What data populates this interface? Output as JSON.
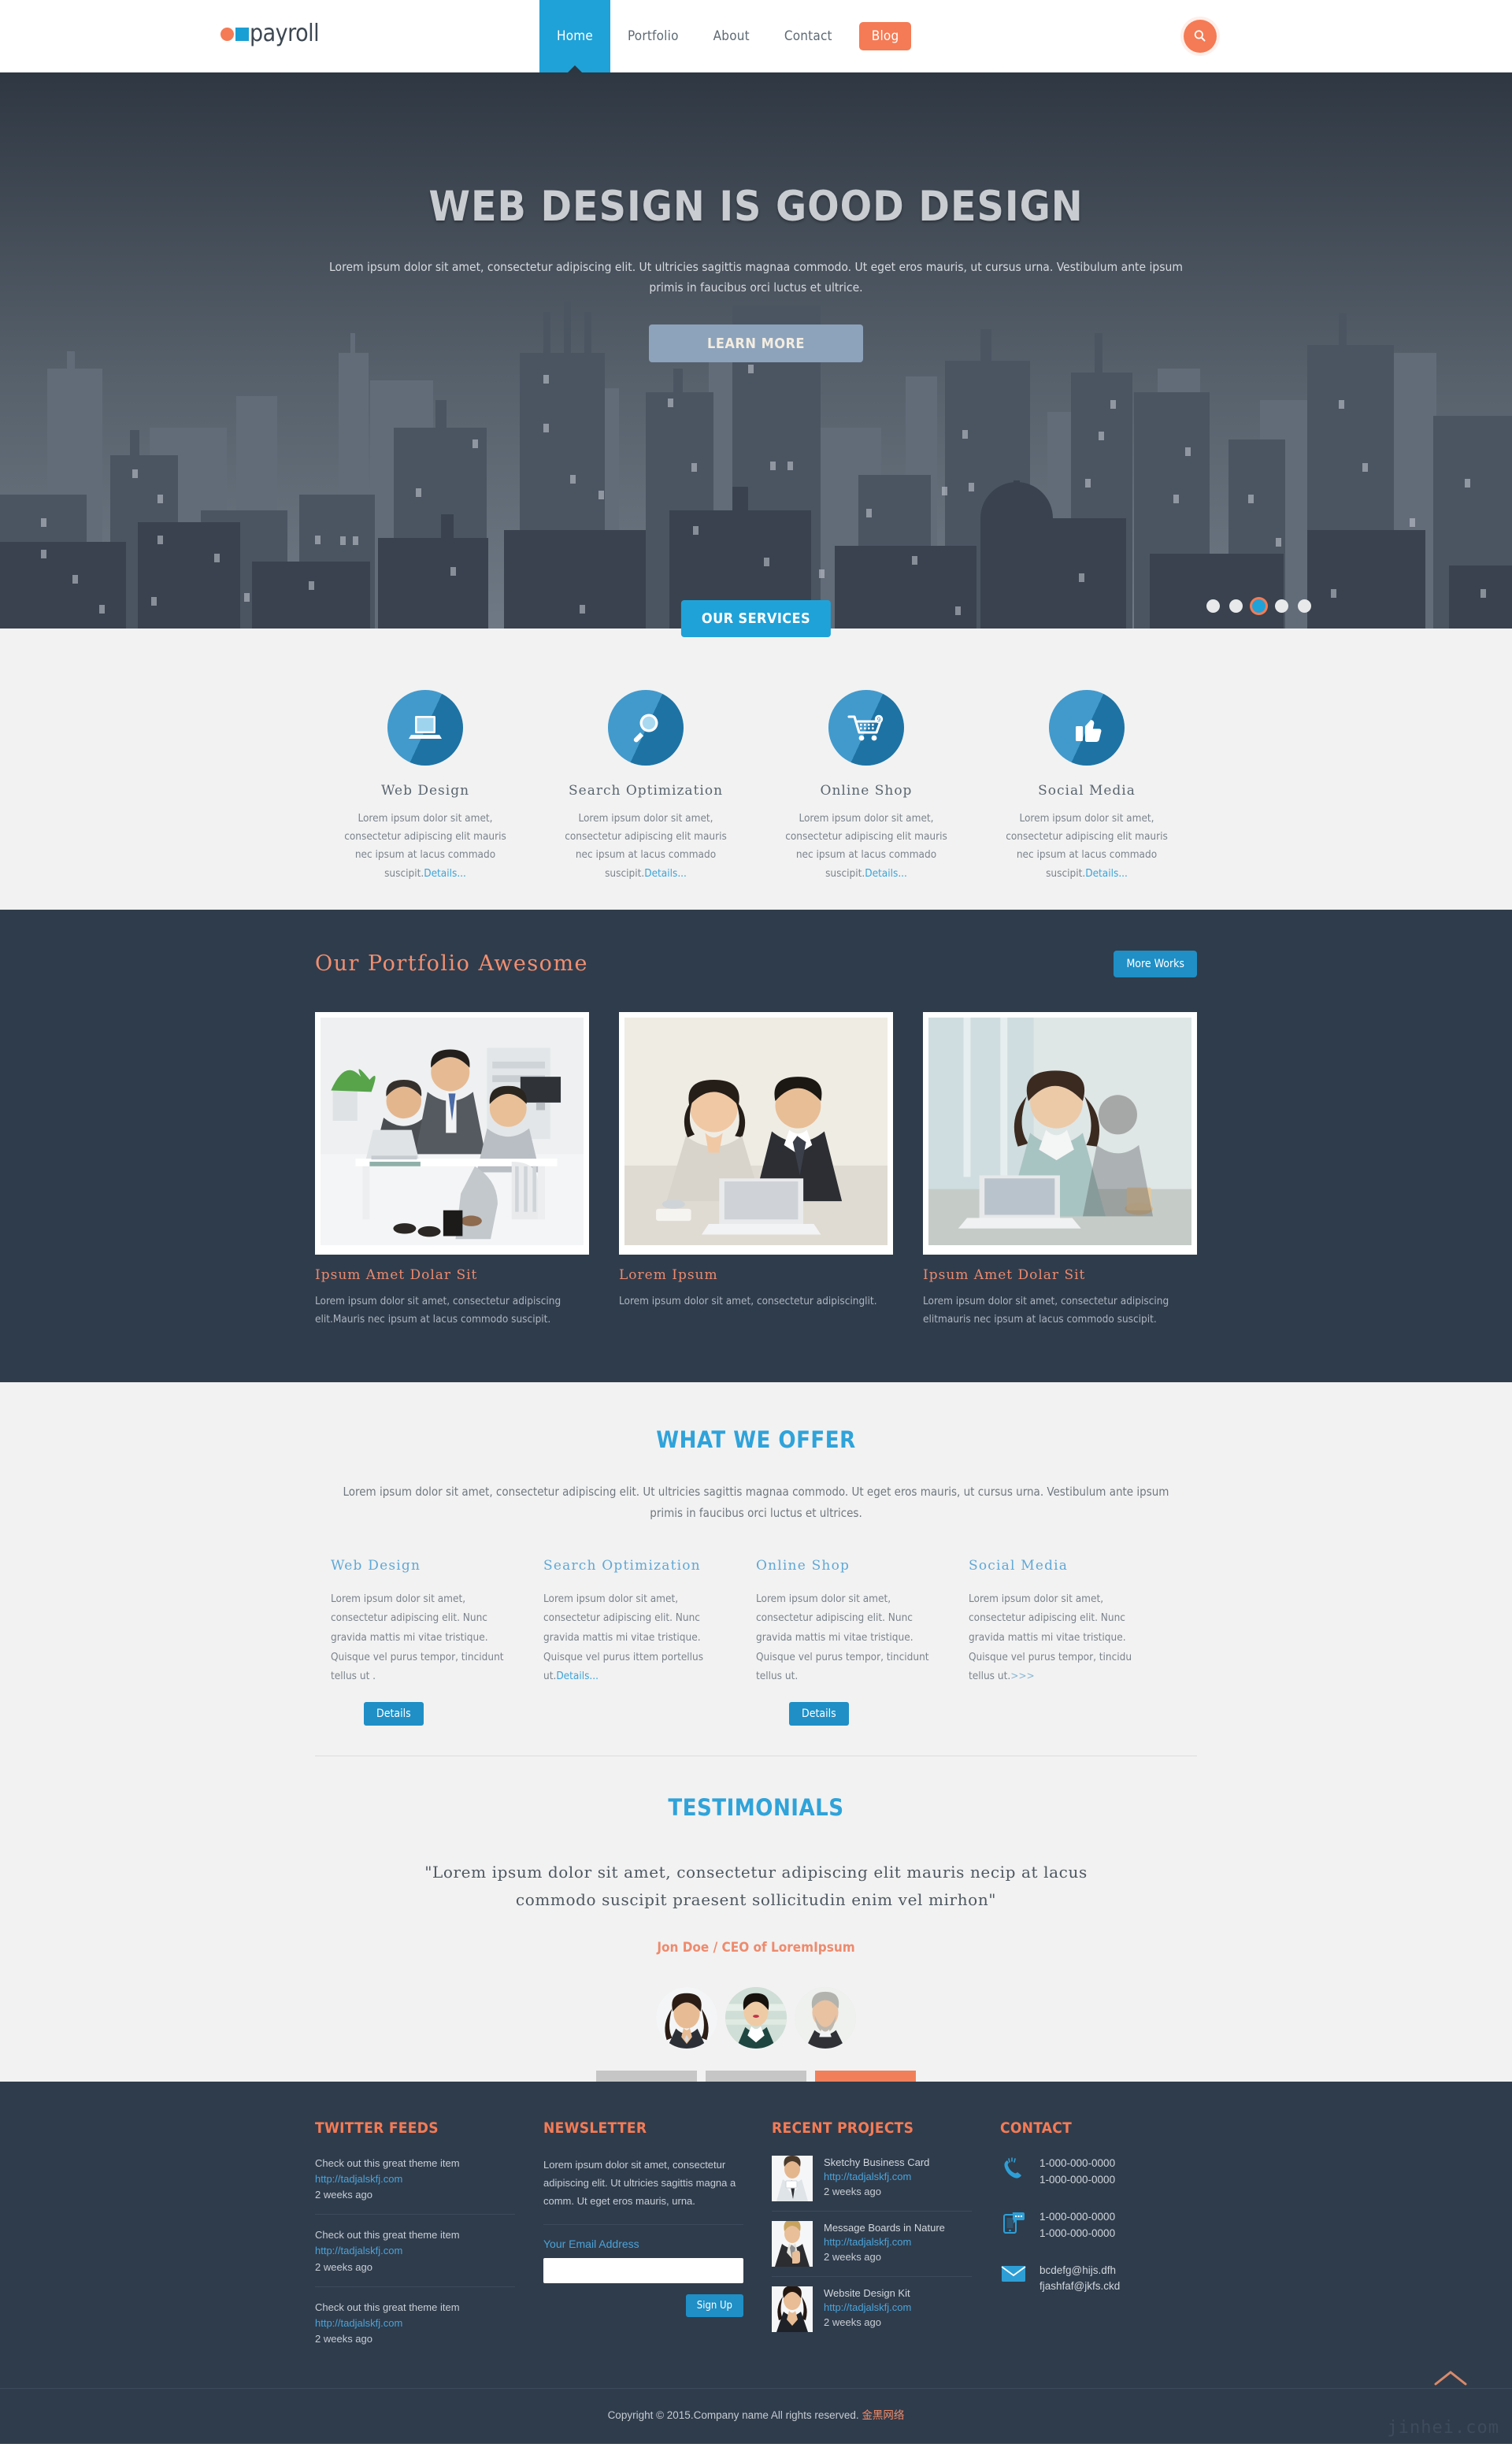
{
  "header": {
    "logo_text": "payroll",
    "nav": [
      {
        "label": "Home",
        "active": true,
        "pill": false
      },
      {
        "label": "Portfolio",
        "active": false,
        "pill": false
      },
      {
        "label": "About",
        "active": false,
        "pill": false
      },
      {
        "label": "Contact",
        "active": false,
        "pill": false
      },
      {
        "label": "Blog",
        "active": false,
        "pill": true
      }
    ],
    "search_icon": "search-icon"
  },
  "hero": {
    "title": "WEB DESIGN IS GOOD DESIGN",
    "paragraph": "Lorem ipsum dolor sit amet, consectetur adipiscing elit. Ut ultricies sagittis magnaa commodo. Ut eget eros mauris, ut cursus urna. Vestibulum ante ipsum primis in faucibus orci luctus et ultrice.",
    "cta_label": "LEARN MORE",
    "slide_count": 5,
    "active_slide": 3
  },
  "services": {
    "tab_label": "OUR SERVICES",
    "items": [
      {
        "title": "Web Design",
        "icon": "laptop-icon",
        "text": "Lorem ipsum dolor sit amet, consectetur adipiscing elit mauris nec ipsum at lacus commado suscipit.",
        "link": "Details..."
      },
      {
        "title": "Search Optimization",
        "icon": "magnifier-icon",
        "text": "Lorem ipsum dolor sit amet, consectetur adipiscing elit mauris nec ipsum at lacus commado suscipit.",
        "link": "Details..."
      },
      {
        "title": "Online Shop",
        "icon": "shopping-cart-icon",
        "text": "Lorem ipsum dolor sit amet, consectetur adipiscing elit mauris nec ipsum at lacus commado suscipit.",
        "link": "Details..."
      },
      {
        "title": "Social Media",
        "icon": "thumbs-up-icon",
        "text": "Lorem ipsum dolor sit amet, consectetur adipiscing elit mauris nec ipsum at lacus commado suscipit.",
        "link": "Details..."
      }
    ]
  },
  "portfolio": {
    "title": "Our Portfolio Awesome",
    "more_label": "More Works",
    "items": [
      {
        "title": "Ipsum Amet Dolar Sit",
        "text": "Lorem ipsum dolor sit amet, consectetur adipiscing elit.Mauris nec ipsum at lacus commodo suscipit.",
        "image": "office-team-meeting-photo"
      },
      {
        "title": "Lorem Ipsum",
        "text": "Lorem ipsum dolor sit amet, consectetur adipiscinglit.",
        "image": "couple-at-laptop-photo"
      },
      {
        "title": "Ipsum Amet Dolar Sit",
        "text": "Lorem ipsum dolor sit amet, consectetur adipiscing elitmauris nec ipsum at lacus commodo suscipit.",
        "image": "woman-working-laptop-photo"
      }
    ]
  },
  "offer": {
    "title": "WHAT WE OFFER",
    "lead": "Lorem ipsum dolor sit amet, consectetur adipiscing elit. Ut ultricies sagittis magnaa commodo. Ut eget eros mauris, ut cursus urna. Vestibulum ante ipsum primis in faucibus orci luctus et ultrices.",
    "columns": [
      {
        "title": "Web Design",
        "text": "Lorem ipsum dolor sit amet, consectetur adipiscing elit. Nunc gravida mattis mi vitae tristique. Quisque vel purus tempor, tincidunt tellus ut .",
        "link": "",
        "suffix": "",
        "button": "Details"
      },
      {
        "title": "Search Optimization",
        "text": "Lorem ipsum dolor sit amet, consectetur adipiscing elit. Nunc gravida mattis mi vitae tristique. Quisque vel purus ittem portellus ut.",
        "link": "Details...",
        "suffix": "",
        "button": ""
      },
      {
        "title": "Online Shop",
        "text": "Lorem ipsum dolor sit amet, consectetur adipiscing elit. Nunc gravida mattis mi vitae tristique. Quisque vel purus tempor, tincidunt tellus ut.",
        "link": "",
        "suffix": "",
        "button": "Details"
      },
      {
        "title": "Social Media",
        "text": "Lorem ipsum dolor sit amet, consectetur adipiscing elit. Nunc gravida mattis mi vitae tristique. Quisque vel purus tempor, tincidu tellus ut.",
        "link": "",
        "suffix": ">>>",
        "button": ""
      }
    ]
  },
  "testimonials": {
    "title": "TESTIMONIALS",
    "quote": "\"Lorem ipsum dolor sit amet, consectetur adipiscing elit mauris necip at lacus commodo suscipit praesent sollicitudin enim vel mirhon\"",
    "author": "Jon Doe / CEO of LoremIpsum",
    "avatars": [
      {
        "name": "avatar-woman-dark-hair",
        "active": false
      },
      {
        "name": "avatar-woman-short-hair",
        "active": false
      },
      {
        "name": "avatar-man-beard",
        "active": true
      }
    ]
  },
  "footer": {
    "twitter": {
      "title": "TWITTER FEEDS",
      "items": [
        {
          "text": "Check out this great theme item",
          "url": "http://tadjalskfj.com",
          "time": "2 weeks ago"
        },
        {
          "text": "Check out this great theme item",
          "url": "http://tadjalskfj.com",
          "time": "2 weeks ago"
        },
        {
          "text": "Check out this great theme item",
          "url": "http://tadjalskfj.com",
          "time": "2 weeks ago"
        }
      ]
    },
    "newsletter": {
      "title": "NEWSLETTER",
      "text": "Lorem ipsum dolor sit amet, consectetur adipiscing elit. Ut ultricies sagittis magna a comm. Ut eget eros mauris, urna.",
      "label": "Your Email Address",
      "input_value": "",
      "input_placeholder": "",
      "button": "Sign Up"
    },
    "projects": {
      "title": "RECENT PROJECTS",
      "items": [
        {
          "name": "Sketchy Business Card",
          "url": "http://tadjalskfj.com",
          "time": "2 weeks ago",
          "thumb": "man-holding-card-photo"
        },
        {
          "name": "Message Boards in Nature",
          "url": "http://tadjalskfj.com",
          "time": "2 weeks ago",
          "thumb": "man-thumbs-up-photo"
        },
        {
          "name": "Website Design Kit",
          "url": "http://tadjalskfj.com",
          "time": "2 weeks ago",
          "thumb": "woman-smiling-photo"
        }
      ]
    },
    "contact": {
      "title": "CONTACT",
      "rows": [
        {
          "icon": "phone-icon",
          "lines": [
            "1-000-000-0000",
            "1-000-000-0000"
          ]
        },
        {
          "icon": "mobile-message-icon",
          "lines": [
            "1-000-000-0000",
            "1-000-000-0000"
          ]
        },
        {
          "icon": "envelope-icon",
          "lines": [
            "bcdefg@hijs.dfh",
            "fjashfaf@jkfs.ckd"
          ]
        }
      ]
    },
    "copyright": "Copyright © 2015.Company name All rights reserved.",
    "copyright_cn": "金黑网络",
    "watermark": "jinhei.com"
  },
  "colors": {
    "brand_blue": "#1fa2d8",
    "brand_orange": "#f47b55",
    "dark_navy": "#2f3c4c",
    "light_gray": "#f2f2f2"
  }
}
